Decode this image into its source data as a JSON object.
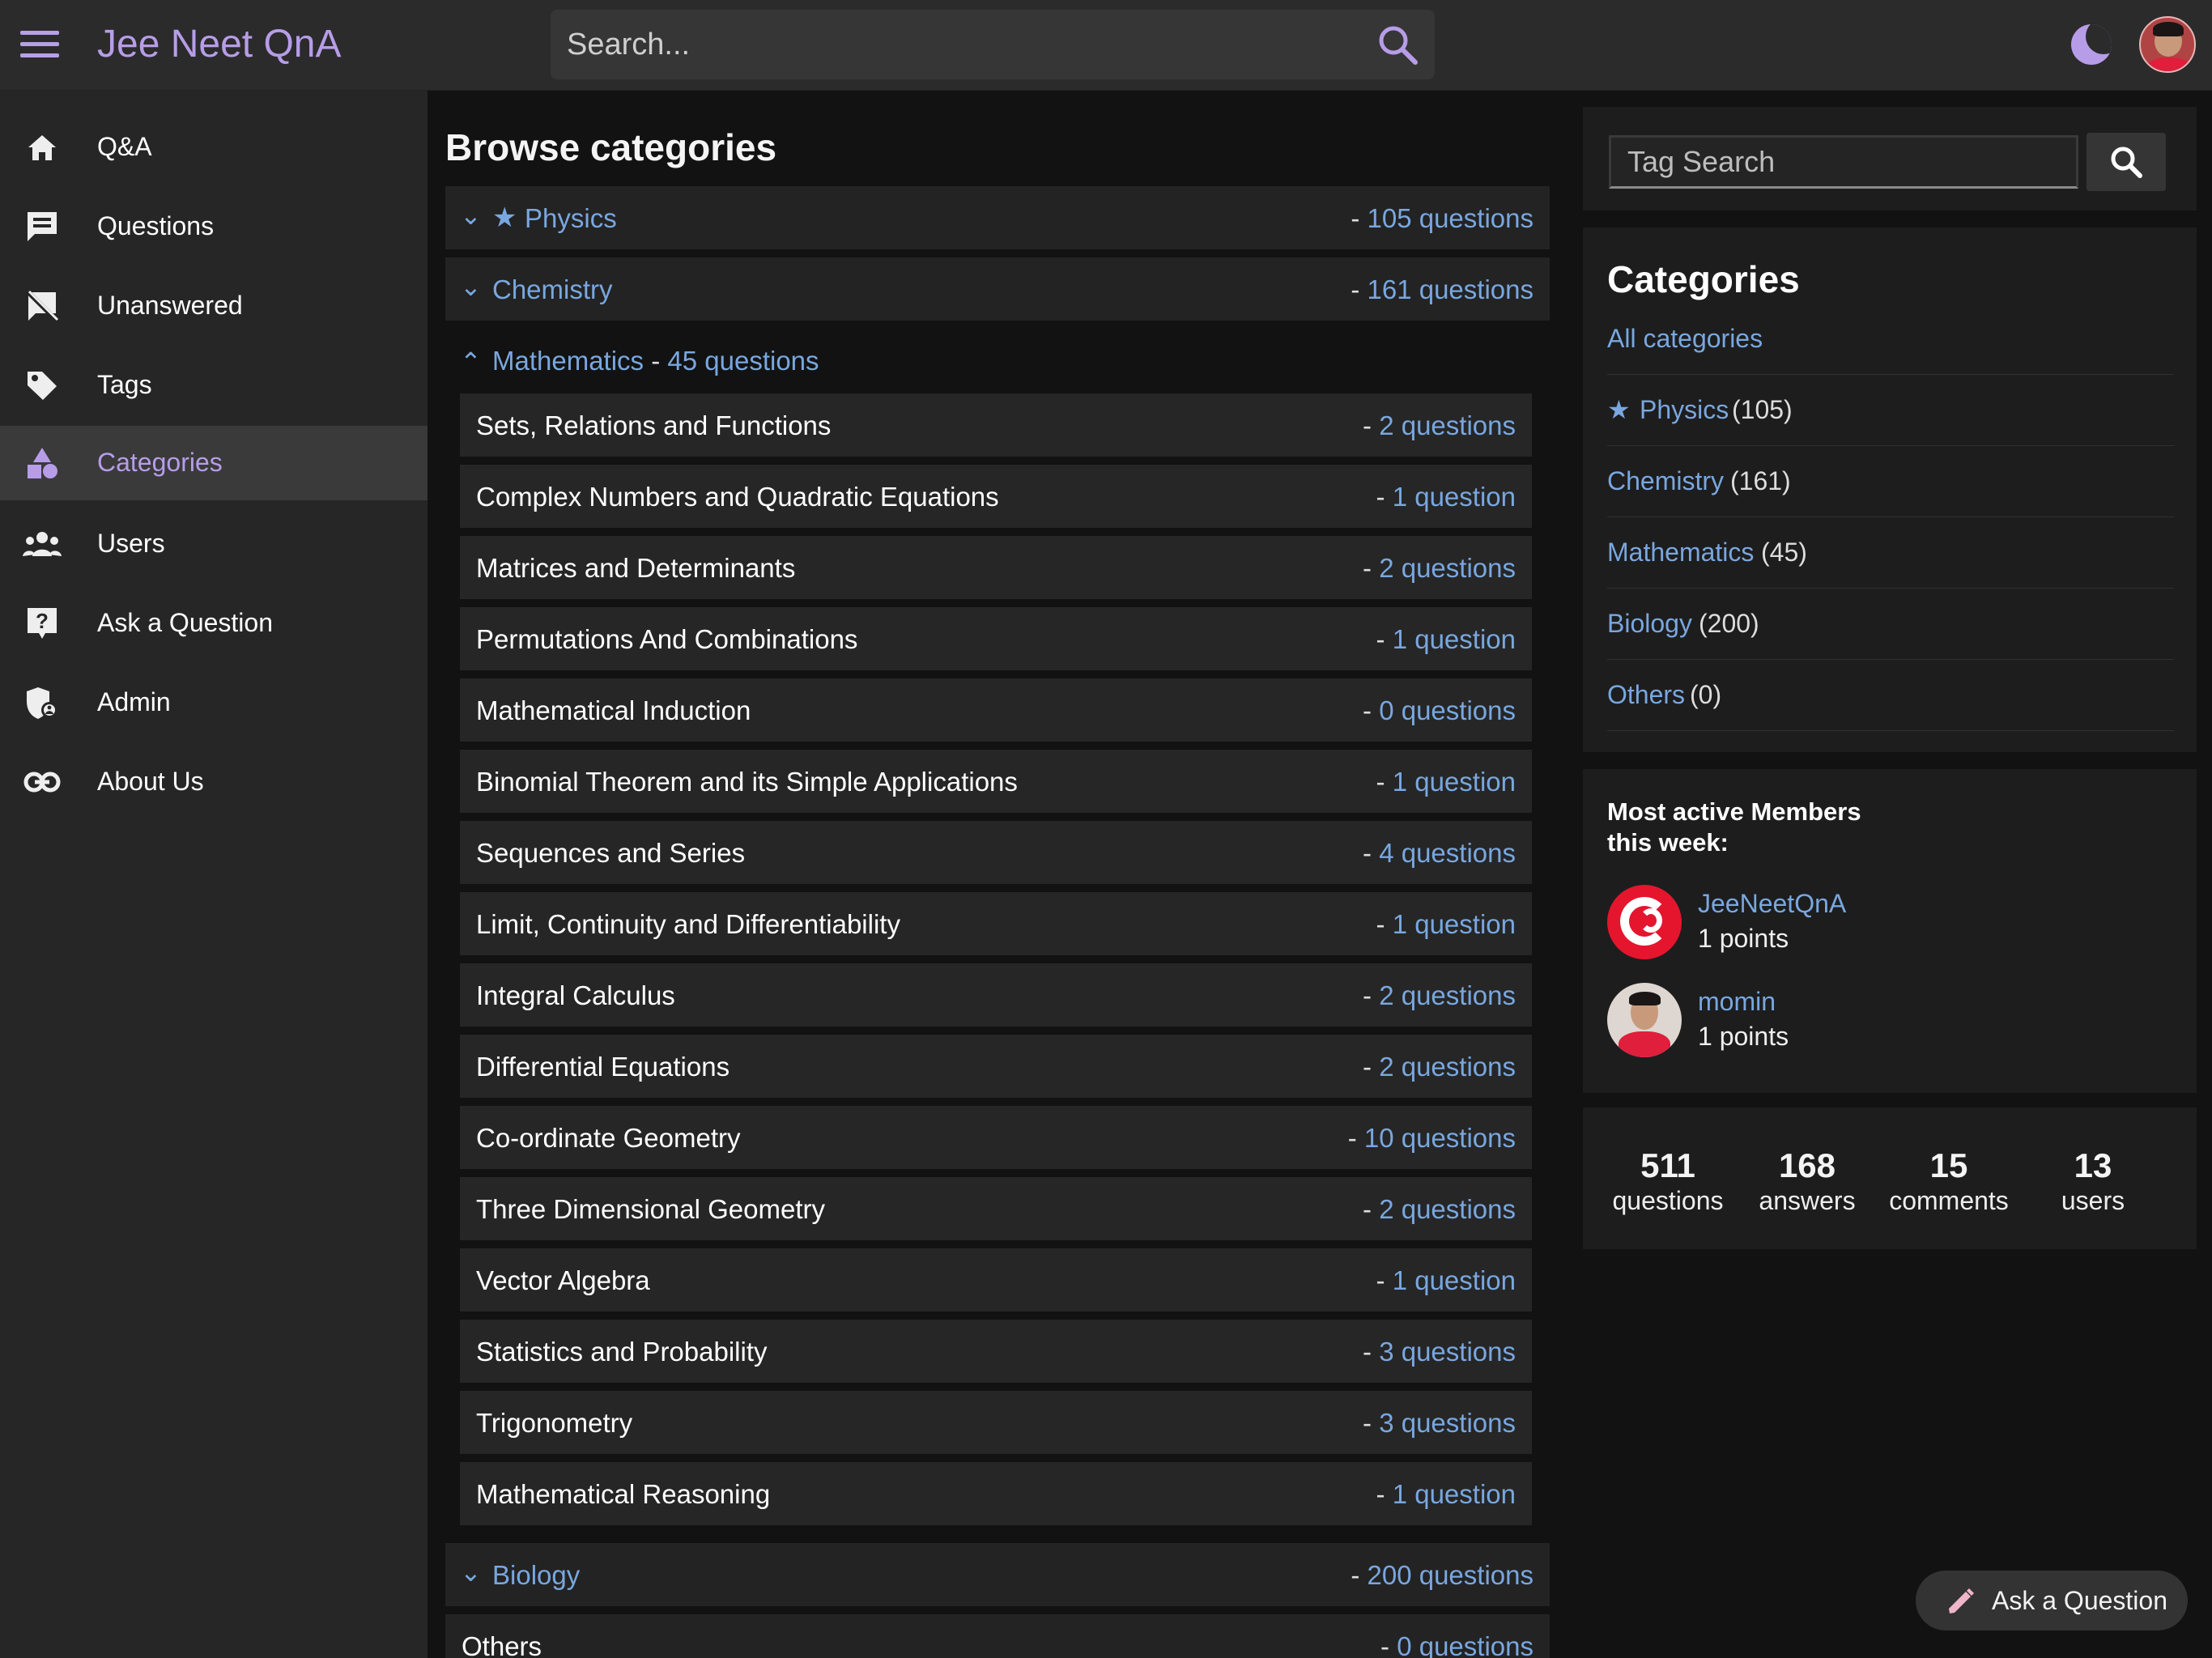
{
  "header": {
    "title": "Jee Neet QnA",
    "search_placeholder": "Search...",
    "menu_icon": "menu-icon",
    "search_icon": "search-icon",
    "theme_icon": "moon-icon",
    "accent_color": "#b79de8"
  },
  "sidebar": {
    "items": [
      {
        "label": "Q&A",
        "icon": "home-icon",
        "active": false
      },
      {
        "label": "Questions",
        "icon": "message-icon",
        "active": false
      },
      {
        "label": "Unanswered",
        "icon": "message-off-icon",
        "active": false
      },
      {
        "label": "Tags",
        "icon": "tag-icon",
        "active": false
      },
      {
        "label": "Categories",
        "icon": "shapes-icon",
        "active": true
      },
      {
        "label": "Users",
        "icon": "users-icon",
        "active": false
      },
      {
        "label": "Ask a Question",
        "icon": "help-icon",
        "active": false
      },
      {
        "label": "Admin",
        "icon": "admin-shield-icon",
        "active": false
      },
      {
        "label": "About Us",
        "icon": "link-icon",
        "active": false
      }
    ]
  },
  "main": {
    "title": "Browse categories",
    "categories": [
      {
        "name": "Physics",
        "count": "105 questions",
        "expanded": false,
        "starred": true
      },
      {
        "name": "Chemistry",
        "count": "161 questions",
        "expanded": false,
        "starred": false
      },
      {
        "name": "Mathematics",
        "count": "45 questions",
        "expanded": true,
        "starred": false
      },
      {
        "name": "Biology",
        "count": "200 questions",
        "expanded": false,
        "starred": false
      },
      {
        "name": "Others",
        "count": "0 questions",
        "expanded": false,
        "starred": false
      }
    ],
    "mathematics_subcategories": [
      {
        "name": "Sets, Relations and Functions",
        "count": "2 questions"
      },
      {
        "name": "Complex Numbers and Quadratic Equations",
        "count": "1 question"
      },
      {
        "name": "Matrices and Determinants",
        "count": "2 questions"
      },
      {
        "name": "Permutations And Combinations",
        "count": "1 question"
      },
      {
        "name": "Mathematical Induction",
        "count": "0 questions"
      },
      {
        "name": "Binomial Theorem and its Simple Applications",
        "count": "1 question"
      },
      {
        "name": "Sequences and Series",
        "count": "4 questions"
      },
      {
        "name": "Limit, Continuity and Differentiability",
        "count": "1 question"
      },
      {
        "name": "Integral Calculus",
        "count": "2 questions"
      },
      {
        "name": "Differential Equations",
        "count": "2 questions"
      },
      {
        "name": "Co-ordinate Geometry",
        "count": "10 questions"
      },
      {
        "name": "Three Dimensional Geometry",
        "count": "2 questions"
      },
      {
        "name": "Vector Algebra",
        "count": "1 question"
      },
      {
        "name": "Statistics and Probability",
        "count": "3 questions"
      },
      {
        "name": "Trigonometry",
        "count": "3 questions"
      },
      {
        "name": "Mathematical Reasoning",
        "count": "1 question"
      }
    ]
  },
  "right_sidebar": {
    "tag_search_placeholder": "Tag Search",
    "categories_title": "Categories",
    "category_links": [
      {
        "name": "All categories",
        "count": ""
      },
      {
        "name": "Physics",
        "count": "(105)"
      },
      {
        "name": "Chemistry",
        "count": "(161)"
      },
      {
        "name": "Mathematics",
        "count": "(45)"
      },
      {
        "name": "Biology",
        "count": "(200)"
      },
      {
        "name": "Others",
        "count": "(0)"
      }
    ],
    "members_title": "Most active Members this week:",
    "members": [
      {
        "name": "JeeNeetQnA",
        "points": "1 points"
      },
      {
        "name": "momin",
        "points": "1 points"
      }
    ],
    "stats": [
      {
        "value": "511",
        "label": "questions"
      },
      {
        "value": "168",
        "label": "answers"
      },
      {
        "value": "15",
        "label": "comments"
      },
      {
        "value": "13",
        "label": "users"
      }
    ]
  },
  "floating_action": {
    "label": "Ask a Question",
    "icon": "pencil-icon"
  }
}
